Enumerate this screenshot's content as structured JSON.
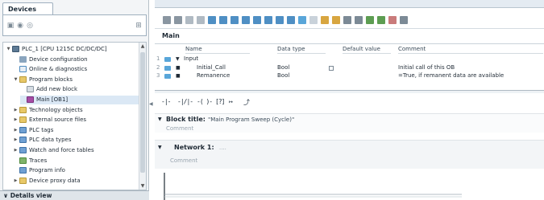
{
  "left_pane": {
    "tab_label": "Devices",
    "toolbar_icons": [
      "new-icon",
      "open-icon",
      "delete-icon",
      "tree-view-icon"
    ],
    "tree": [
      {
        "indent": 0,
        "twisty": "▼",
        "icon": "plc-icon",
        "label": "PLC_1 [CPU 1215C DC/DC/DC]"
      },
      {
        "indent": 1,
        "twisty": "",
        "icon": "device-config-icon",
        "label": "Device configuration"
      },
      {
        "indent": 1,
        "twisty": "",
        "icon": "diagnostics-icon",
        "label": "Online & diagnostics"
      },
      {
        "indent": 1,
        "twisty": "▼",
        "icon": "folder-icon",
        "label": "Program blocks"
      },
      {
        "indent": 2,
        "twisty": "",
        "icon": "add-block-icon",
        "label": "Add new block"
      },
      {
        "indent": 2,
        "twisty": "",
        "icon": "ob-block-icon",
        "label": "Main [OB1]"
      },
      {
        "indent": 1,
        "twisty": "▶",
        "icon": "folder-icon",
        "label": "Technology objects"
      },
      {
        "indent": 1,
        "twisty": "▶",
        "icon": "folder-icon",
        "label": "External source files"
      },
      {
        "indent": 1,
        "twisty": "▶",
        "icon": "tags-icon",
        "label": "PLC tags"
      },
      {
        "indent": 1,
        "twisty": "▶",
        "icon": "datatypes-icon",
        "label": "PLC data types"
      },
      {
        "indent": 1,
        "twisty": "▶",
        "icon": "watch-icon",
        "label": "Watch and force tables"
      },
      {
        "indent": 1,
        "twisty": "",
        "icon": "traces-icon",
        "label": "Traces"
      },
      {
        "indent": 1,
        "twisty": "",
        "icon": "program-info-icon",
        "label": "Program info"
      },
      {
        "indent": 1,
        "twisty": "▶",
        "icon": "proxy-icon",
        "label": "Device proxy data"
      }
    ],
    "details_label": "Details view"
  },
  "editor": {
    "block_name": "Main",
    "interface": {
      "columns": [
        "Name",
        "Data type",
        "Default value",
        "Comment"
      ],
      "rows": [
        {
          "num": "1",
          "name": "Input",
          "section": true,
          "type": "",
          "comment": ""
        },
        {
          "num": "2",
          "name": "Initial_Call",
          "section": false,
          "type": "Bool",
          "comment": "Initial call of this OB"
        },
        {
          "num": "3",
          "name": "Remanence",
          "section": false,
          "type": "Bool",
          "comment": "=True, if remanent data are available"
        }
      ]
    },
    "ladder_toolbar": [
      "-|-",
      "-|/|-",
      "-( )-",
      "[?]",
      "↦",
      "⤴"
    ],
    "block_title_label": "Block title:",
    "block_title_value": "\"Main Program Sweep (Cycle)\"",
    "block_comment": "Comment",
    "network_label": "Network 1:",
    "network_title": "....",
    "network_comment": "Comment"
  },
  "colors": {
    "accent": "#59a6d9",
    "ob_block": "#a64ca6",
    "folder": "#e8c868"
  }
}
